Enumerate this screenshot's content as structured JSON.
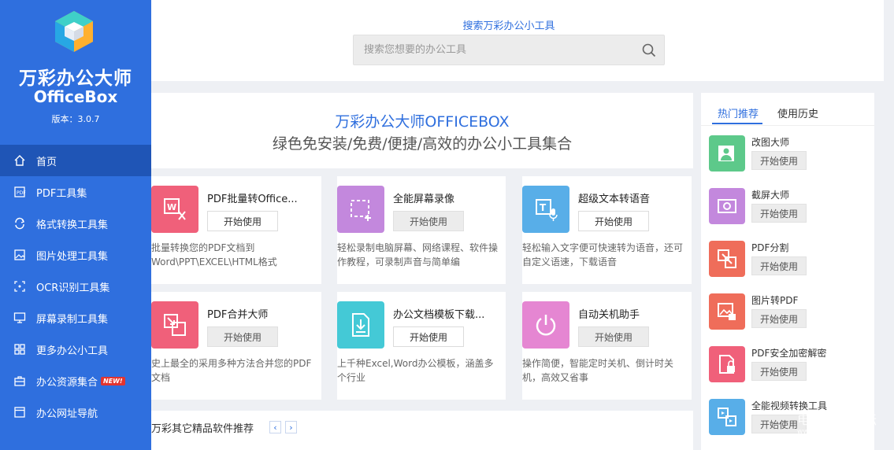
{
  "app": {
    "name_cn": "万彩办公大师",
    "name_en": "OfficeBox",
    "version": "版本：3.0.7"
  },
  "colors": {
    "accent": "#2f6fde",
    "sidebar": "#2f6fde",
    "sidebar_active": "#1f55b6",
    "badge": "#e3342f"
  },
  "sidebar": {
    "items": [
      {
        "label": "首页",
        "icon": "home-icon"
      },
      {
        "label": "PDF工具集",
        "icon": "pdf-icon"
      },
      {
        "label": "格式转换工具集",
        "icon": "convert-icon"
      },
      {
        "label": "图片处理工具集",
        "icon": "image-icon"
      },
      {
        "label": "OCR识别工具集",
        "icon": "ocr-icon"
      },
      {
        "label": "屏幕录制工具集",
        "icon": "monitor-icon"
      },
      {
        "label": "更多办公小工具",
        "icon": "grid-icon"
      },
      {
        "label": "办公资源集合",
        "icon": "briefcase-icon",
        "badge": "NEW!"
      },
      {
        "label": "办公网址导航",
        "icon": "browser-icon"
      }
    ]
  },
  "search": {
    "title": "搜索万彩办公小工具",
    "placeholder": "搜索您想要的办公工具"
  },
  "hero": {
    "title": "万彩办公大师OFFICEBOX",
    "subtitle": "绿色免安装/免费/便捷/高效的办公小工具集合"
  },
  "cards": [
    {
      "name": "PDF批量转Office...",
      "button": "开始使用",
      "desc": "批量转换您的PDF文档到Word\\PPT\\EXCEL\\HTML格式",
      "color": "#f0607a",
      "icon": "pdf-to-office-icon"
    },
    {
      "name": "全能屏幕录像",
      "button": "开始使用",
      "desc": "轻松录制电脑屏幕、网络课程、软件操作教程，可录制声音与简单编",
      "color": "#c388dd",
      "icon": "screen-record-icon"
    },
    {
      "name": "超级文本转语音",
      "button": "开始使用",
      "desc": "轻松输入文字便可快速转为语音，还可自定义语速，下载语音",
      "color": "#58aee8",
      "icon": "text-to-speech-icon"
    },
    {
      "name": "PDF合并大师",
      "button": "开始使用",
      "desc": "史上最全的采用多种方法合并您的PDF文档",
      "color": "#f0607a",
      "icon": "pdf-merge-icon"
    },
    {
      "name": "办公文档模板下载...",
      "button": "开始使用",
      "desc": "上千种Excel,Word办公模板，涵盖多个行业",
      "color": "#44c9d6",
      "icon": "document-template-icon"
    },
    {
      "name": "自动关机助手",
      "button": "开始使用",
      "desc": "操作简便，智能定时关机、倒计时关机，高效又省事",
      "color": "#e586d2",
      "icon": "power-icon"
    }
  ],
  "recommend": {
    "title": "万彩其它精品软件推荐",
    "prev": "‹",
    "next": "›"
  },
  "right_panel": {
    "tabs": [
      "热门推荐",
      "使用历史"
    ],
    "items": [
      {
        "name": "改图大师",
        "button": "开始使用",
        "color": "#5dc98a",
        "icon": "photo-edit-icon"
      },
      {
        "name": "截屏大师",
        "button": "开始使用",
        "color": "#c388dd",
        "icon": "screenshot-icon"
      },
      {
        "name": "PDF分割",
        "button": "开始使用",
        "color": "#ef6d5a",
        "icon": "pdf-split-icon"
      },
      {
        "name": "图片转PDF",
        "button": "开始使用",
        "color": "#ef6d5a",
        "icon": "image-to-pdf-icon"
      },
      {
        "name": "PDF安全加密解密",
        "button": "开始使用",
        "color": "#f0607a",
        "icon": "pdf-lock-icon"
      },
      {
        "name": "全能视频转换工具",
        "button": "开始使用",
        "color": "#58aee8",
        "icon": "video-convert-icon"
      }
    ]
  },
  "watermark": {
    "line1": "电脑软件论坛",
    "line2": "www.pcpcsx.com"
  }
}
